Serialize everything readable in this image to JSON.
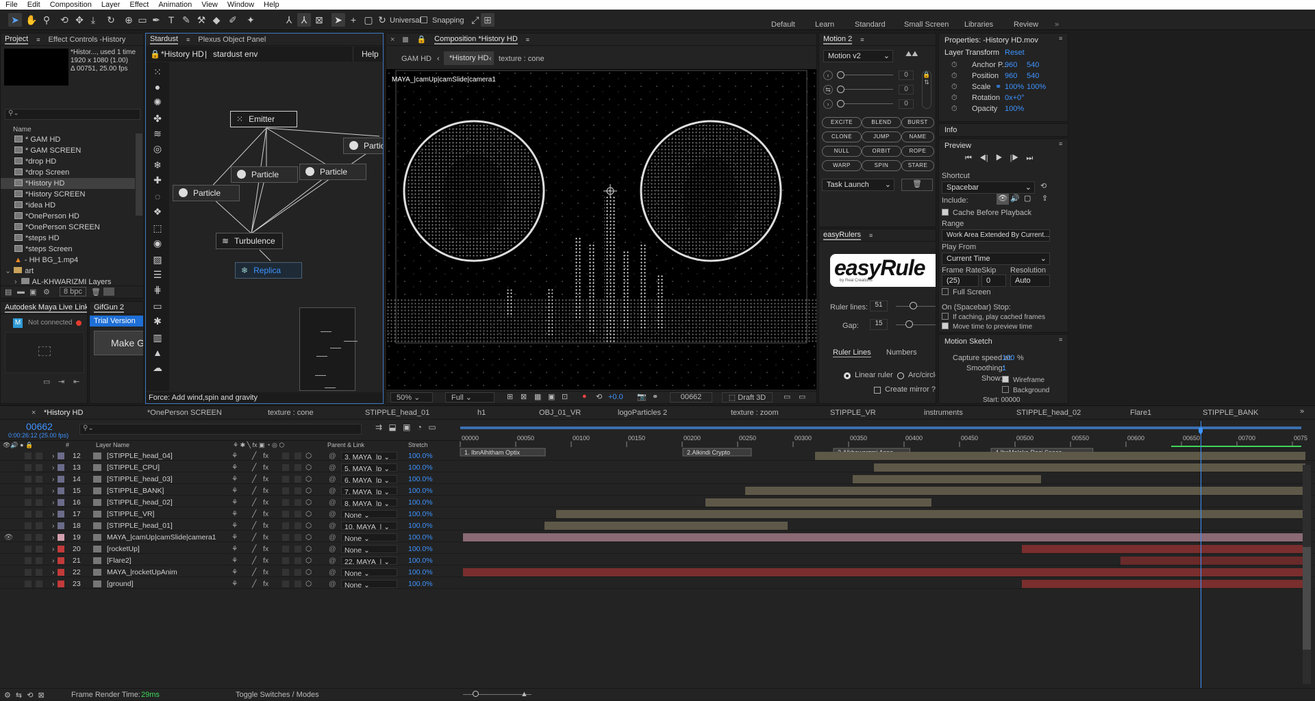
{
  "menu": [
    "File",
    "Edit",
    "Composition",
    "Layer",
    "Effect",
    "Animation",
    "View",
    "Window",
    "Help"
  ],
  "toolbar": {
    "universal": "Universal",
    "snapping": "Snapping"
  },
  "workspaces": [
    "Default",
    "Learn",
    "Standard",
    "Small Screen",
    "Libraries",
    "Review"
  ],
  "project": {
    "tab": "Project",
    "tab2": "Effect Controls -History",
    "comp_name": "*Histor...",
    "used": ", used 1 time",
    "res": "1920 x 1080 (1.00)",
    "dur": "Δ 00751, 25.00 fps",
    "col_name": "Name",
    "items": [
      "* GAM HD",
      "* GAM SCREEN",
      "*drop HD",
      "*drop Screen",
      "*History HD",
      "*History SCREEN",
      "*idea HD",
      "*OnePerson HD",
      "*OnePerson SCREEN",
      "*steps HD",
      "*steps Screen",
      "- HH BG_1.mp4",
      "art",
      "AL-KHWARIZMI Layers"
    ],
    "bpc": "8 bpc"
  },
  "mayalink": {
    "title": "Autodesk Maya Live Link",
    "status": "Not connected"
  },
  "gifgun": {
    "title": "GifGun 2",
    "trial": "Trial Version",
    "make": "Make GIF"
  },
  "stardust": {
    "tab": "Stardust",
    "tab2": "Plexus Object Panel",
    "comp": "*History HD",
    "sep": "|",
    "env": "stardust env",
    "help": "Help",
    "nodes": {
      "emitter": "Emitter",
      "particle1": "Particle",
      "particle2": "Particle",
      "particle3": "Particle",
      "particle4": "Particle",
      "turbulence": "Turbulence",
      "replica": "Replica"
    },
    "status": "Force: Add wind,spin and gravity"
  },
  "composition": {
    "tab": "Composition *History HD",
    "crumbs": [
      "GAM HD",
      "*History HD",
      "texture : cone"
    ],
    "camera": "MAYA_|camUp|camSlide|camera1",
    "zoom": "50%",
    "quality": "Full",
    "exposure": "+0.0",
    "timecode": "00662",
    "renderer": "Draft 3D"
  },
  "motion2": {
    "tab": "Motion 2",
    "version": "Motion v2",
    "values": [
      "0",
      "0",
      "0"
    ],
    "buttons": [
      "EXCITE",
      "BLEND",
      "BURST",
      "CLONE",
      "JUMP",
      "NAME",
      "NULL",
      "ORBIT",
      "ROPE",
      "WARP",
      "SPIN",
      "STARE"
    ],
    "task": "Task Launch"
  },
  "easyrulers": {
    "tab": "easyRulers",
    "logo": "easyRule",
    "sub": "by Real Creations",
    "ruler_lines_label": "Ruler lines:",
    "ruler_lines": "51",
    "gap_label": "Gap:",
    "gap": "15",
    "tab_a": "Ruler Lines",
    "tab_b": "Numbers",
    "opt1": "Linear ruler",
    "opt2": "Arc/circle",
    "mirror": "Create mirror ?"
  },
  "properties": {
    "title": "Properties: -History HD.mov",
    "section": "Layer Transform",
    "reset": "Reset",
    "rows": [
      {
        "k": "Anchor P...",
        "v1": "960",
        "v2": "540"
      },
      {
        "k": "Position",
        "v1": "960",
        "v2": "540"
      },
      {
        "k": "Scale",
        "v1": "100%",
        "v2": "100%"
      },
      {
        "k": "Rotation",
        "v1": "0x+0°",
        "v2": ""
      },
      {
        "k": "Opacity",
        "v1": "100%",
        "v2": ""
      }
    ]
  },
  "info": {
    "title": "Info"
  },
  "preview": {
    "title": "Preview",
    "shortcut_label": "Shortcut",
    "shortcut": "Spacebar",
    "include": "Include:",
    "cache": "Cache Before Playback",
    "range_label": "Range",
    "range": "Work Area Extended By Current...",
    "playfrom_label": "Play From",
    "playfrom": "Current Time",
    "fr_label": "Frame Rate",
    "skip_label": "Skip",
    "res_label": "Resolution",
    "fr": "(25)",
    "skip": "0",
    "res": "Auto",
    "fullscreen": "Full Screen",
    "stop": "On (Spacebar) Stop:",
    "stop1": "If caching, play cached frames",
    "stop2": "Move time to preview time"
  },
  "sketch": {
    "title": "Motion Sketch",
    "speed_label": "Capture speed at:",
    "speed": "100",
    "pct": "%",
    "smooth_label": "Smoothing:",
    "smooth": "1",
    "show": "Show:",
    "wire": "Wireframe",
    "bg": "Background",
    "start": "Start: 00000"
  },
  "timeline": {
    "tabs": [
      "*History HD",
      "*OnePerson SCREEN",
      "texture : cone",
      "STIPPLE_head_01",
      "h1",
      "OBJ_01_VR",
      "logoParticles 2",
      "texture : zoom",
      "STIPPLE_VR",
      "instruments",
      "STIPPLE_head_02",
      "Flare1",
      "STIPPLE_BANK"
    ],
    "time": "00662",
    "time_sub": "0:00:26:12 (25.00 fps)",
    "col_layer": "Layer Name",
    "col_parent": "Parent & Link",
    "col_stretch": "Stretch",
    "ticks": [
      "00000",
      "00050",
      "00100",
      "00150",
      "00200",
      "00250",
      "00300",
      "00350",
      "00400",
      "00450",
      "00500",
      "00550",
      "00600",
      "00650",
      "00700",
      "0075"
    ],
    "markers": [
      "1. IbnAlhitham Optix",
      "2.Alkindi Crypto",
      "3.Alkhawarzmi Apps",
      "4.IbnMalaka   Razi Space"
    ],
    "layers": [
      {
        "n": "12",
        "name": "[STIPPLE_head_04]",
        "parent": "3. MAYA_|p",
        "st": "100.0%",
        "c": "#6b6b8a"
      },
      {
        "n": "13",
        "name": "[STIPPLE_CPU]",
        "parent": "5. MAYA_|p",
        "st": "100.0%",
        "c": "#6b6b8a"
      },
      {
        "n": "14",
        "name": "[STIPPLE_head_03]",
        "parent": "6. MAYA_|p",
        "st": "100.0%",
        "c": "#6b6b8a"
      },
      {
        "n": "15",
        "name": "[STIPPLE_BANK]",
        "parent": "7. MAYA_|p",
        "st": "100.0%",
        "c": "#6b6b8a"
      },
      {
        "n": "16",
        "name": "[STIPPLE_head_02]",
        "parent": "8. MAYA_|p",
        "st": "100.0%",
        "c": "#6b6b8a"
      },
      {
        "n": "17",
        "name": "[STIPPLE_VR]",
        "parent": "None",
        "st": "100.0%",
        "c": "#6b6b8a"
      },
      {
        "n": "18",
        "name": "[STIPPLE_head_01]",
        "parent": "10. MAYA_|",
        "st": "100.0%",
        "c": "#6b6b8a"
      },
      {
        "n": "19",
        "name": "MAYA_|camUp|camSlide|camera1",
        "parent": "None",
        "st": "100.0%",
        "c": "#d4a0b0"
      },
      {
        "n": "20",
        "name": "[rocketUp]",
        "parent": "None",
        "st": "100.0%",
        "c": "#c23a3a"
      },
      {
        "n": "21",
        "name": "[Flare2]",
        "parent": "22. MAYA_|",
        "st": "100.0%",
        "c": "#c23a3a"
      },
      {
        "n": "22",
        "name": "MAYA_|rocketUpAnim",
        "parent": "None",
        "st": "100.0%",
        "c": "#c23a3a"
      },
      {
        "n": "23",
        "name": "[ground]",
        "parent": "None",
        "st": "100.0%",
        "c": "#c23a3a"
      }
    ],
    "render_label": "Frame Render Time:",
    "render": "29ms",
    "toggle": "Toggle Switches / Modes"
  }
}
